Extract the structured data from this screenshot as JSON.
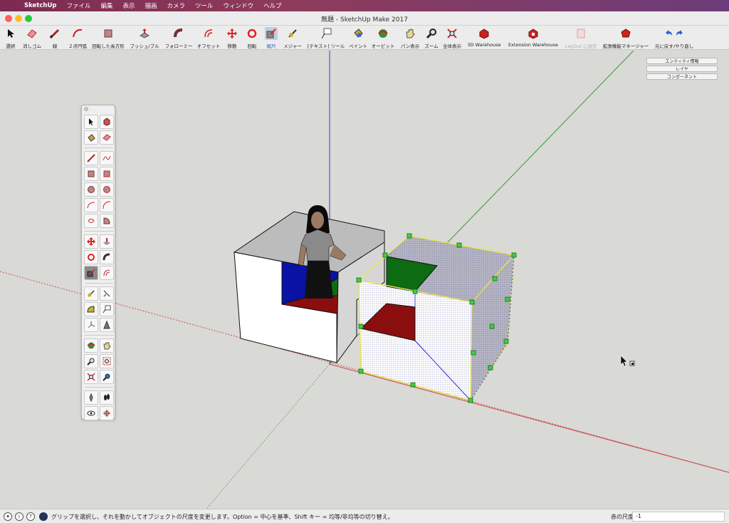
{
  "menubar": {
    "app": "SketchUp",
    "items": [
      "ファイル",
      "編集",
      "表示",
      "描画",
      "カメラ",
      "ツール",
      "ウィンドウ",
      "ヘルプ"
    ]
  },
  "window": {
    "title": "無題 - SketchUp Make 2017"
  },
  "toolbar": {
    "select": "選択",
    "eraser": "消しゴム",
    "line": "線",
    "arc": "２点円弧",
    "rect": "回転した長方形",
    "pushpull": "プッシュ/プル",
    "followme": "フォローミー",
    "offset": "オフセット",
    "move": "移動",
    "rotate": "回転",
    "scale": "縮尺",
    "measure": "メジャー",
    "text": "[テキスト] ツール",
    "paint": "ペイント",
    "orbit": "オービット",
    "pan": "パン表示",
    "zoom": "ズーム",
    "zoomext": "全体表示",
    "warehouse": "3D Warehouse",
    "extwarehouse": "Extension Warehouse",
    "layout": "LayOut に送信",
    "extmanager": "拡張機能マネージャー",
    "undoredo": "元に戻す/やり直し"
  },
  "trays": [
    "エンティティ情報",
    "レイヤ",
    "コンポーネント"
  ],
  "status": {
    "message": "グリップを選択し、それを動かしてオブジェクトの尺度を変更します。Option = 中心を基準、Shift キー = 均等/非均等の切り替え。",
    "measure_label": "赤の尺度",
    "measure_value": "-1"
  },
  "colors": {
    "selection": "#e9e84a",
    "grip": "#3fcf3f",
    "red_face": "#8b0e0e",
    "green_face": "#0d6b12",
    "blue_face": "#0a12a6"
  }
}
